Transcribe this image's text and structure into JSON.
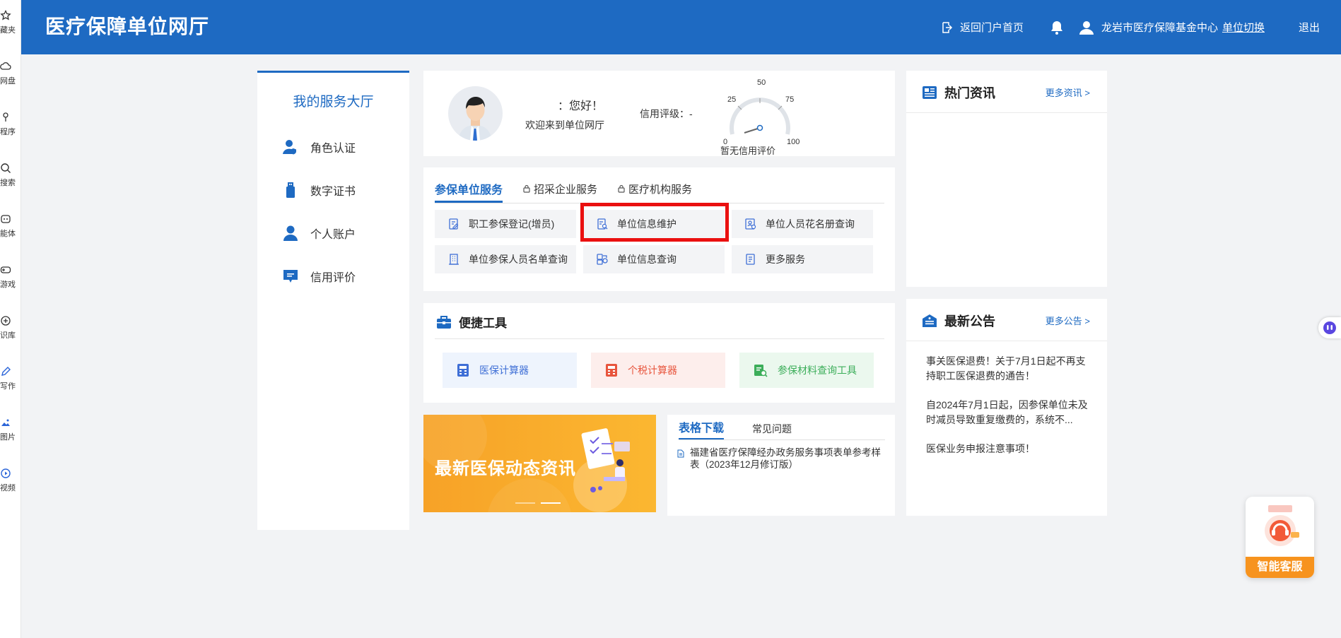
{
  "leftstrip": {
    "items": [
      {
        "label": "藏夹",
        "icon": "star-icon"
      },
      {
        "label": "网盘",
        "icon": "cloud-icon"
      },
      {
        "label": "程序",
        "icon": "app-icon"
      },
      {
        "label": "搜索",
        "icon": "search-icon"
      },
      {
        "label": "能体",
        "icon": "agent-icon"
      },
      {
        "label": "游戏",
        "icon": "game-icon"
      },
      {
        "label": "识库",
        "icon": "knowledge-icon"
      },
      {
        "label": "写作",
        "icon": "write-icon"
      },
      {
        "label": "图片",
        "icon": "image-icon"
      },
      {
        "label": "视频",
        "icon": "video-icon"
      }
    ]
  },
  "header": {
    "title": "医疗保障单位网厅",
    "back_home": "返回门户首页",
    "org_name": "龙岩市医疗保障基金中心",
    "switch_unit": "单位切换",
    "logout": "退出",
    "bg_color": "#1e6ac2"
  },
  "service_hall": {
    "title": "我的服务大厅",
    "items": [
      {
        "label": "角色认证",
        "icon": "role-auth-icon"
      },
      {
        "label": "数字证书",
        "icon": "usb-key-icon"
      },
      {
        "label": "个人账户",
        "icon": "user-icon"
      },
      {
        "label": "信用评价",
        "icon": "message-icon"
      }
    ]
  },
  "welcome": {
    "greeting": "：您好！",
    "sub": "欢迎来到单位网厅",
    "credit_label": "信用评级：-",
    "gauge_ticks": [
      "0",
      "25",
      "50",
      "75",
      "100"
    ],
    "no_credit": "暂无信用评价"
  },
  "services": {
    "tabs": [
      {
        "label": "参保单位服务",
        "active": true,
        "locked": false
      },
      {
        "label": "招采企业服务",
        "active": false,
        "locked": true
      },
      {
        "label": "医疗机构服务",
        "active": false,
        "locked": true
      }
    ],
    "buttons": [
      {
        "label": "职工参保登记(增员)",
        "icon": "edit-doc-icon"
      },
      {
        "label": "单位信息维护",
        "icon": "doc-search-icon"
      },
      {
        "label": "单位人员花名册查询",
        "icon": "roster-icon"
      },
      {
        "label": "单位参保人员名单查询",
        "icon": "building-icon"
      },
      {
        "label": "单位信息查询",
        "icon": "info-query-icon"
      },
      {
        "label": "更多服务",
        "icon": "more-doc-icon"
      }
    ]
  },
  "tools": {
    "title": "便捷工具",
    "items": [
      {
        "label": "医保计算器",
        "color": "#3f6fd6",
        "bg": "#eef4fd"
      },
      {
        "label": "个税计算器",
        "color": "#e8553d",
        "bg": "#fdeeec"
      },
      {
        "label": "参保材料查询工具",
        "color": "#3cae5a",
        "bg": "#ebf8ee"
      }
    ]
  },
  "banner": {
    "text": "最新医保动态资讯"
  },
  "forms": {
    "tabs": [
      "表格下载",
      "常见问题"
    ],
    "item": "福建省医疗保障经办政务服务事项表单参考样表（2023年12月修订版）"
  },
  "news": {
    "title": "热门资讯",
    "more": "更多资讯 >"
  },
  "notice": {
    "title": "最新公告",
    "more": "更多公告 >",
    "items": [
      "事关医保退费！关于7月1日起不再支持职工医保退费的通告！",
      "自2024年7月1日起，因参保单位未及时减员导致重复缴费的，系统不...",
      "医保业务申报注意事项！"
    ]
  },
  "assistant": {
    "label": "智能客服"
  }
}
